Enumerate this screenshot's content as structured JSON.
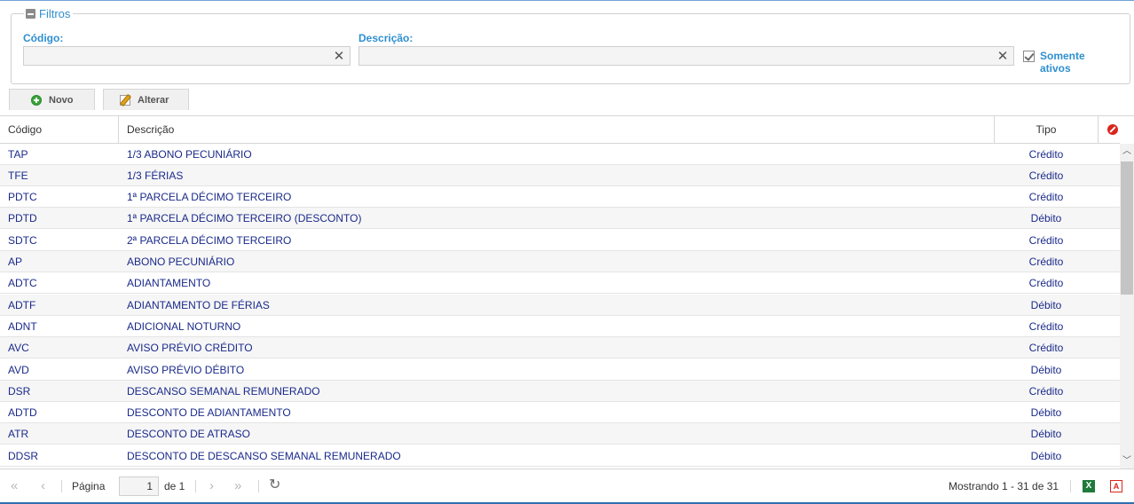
{
  "filters": {
    "legend": "Filtros",
    "codigo_label": "Código:",
    "codigo_value": "",
    "descricao_label": "Descrição:",
    "descricao_value": "",
    "clear_glyph": "✕",
    "somente_ativos_label": "Somente ativos",
    "somente_ativos_checked": true
  },
  "toolbar": {
    "novo_label": "Novo",
    "alterar_label": "Alterar"
  },
  "grid": {
    "columns": {
      "codigo": "Código",
      "descricao": "Descrição",
      "tipo": "Tipo"
    },
    "rows": [
      {
        "codigo": "TAP",
        "descricao": "1/3 ABONO PECUNIÁRIO",
        "tipo": "Crédito"
      },
      {
        "codigo": "TFE",
        "descricao": "1/3 FÉRIAS",
        "tipo": "Crédito"
      },
      {
        "codigo": "PDTC",
        "descricao": "1ª PARCELA DÉCIMO TERCEIRO",
        "tipo": "Crédito"
      },
      {
        "codigo": "PDTD",
        "descricao": "1ª PARCELA DÉCIMO TERCEIRO (DESCONTO)",
        "tipo": "Débito"
      },
      {
        "codigo": "SDTC",
        "descricao": "2ª PARCELA DÉCIMO TERCEIRO",
        "tipo": "Crédito"
      },
      {
        "codigo": "AP",
        "descricao": "ABONO PECUNIÁRIO",
        "tipo": "Crédito"
      },
      {
        "codigo": "ADTC",
        "descricao": "ADIANTAMENTO",
        "tipo": "Crédito"
      },
      {
        "codigo": "ADTF",
        "descricao": "ADIANTAMENTO DE FÉRIAS",
        "tipo": "Débito"
      },
      {
        "codigo": "ADNT",
        "descricao": "ADICIONAL NOTURNO",
        "tipo": "Crédito"
      },
      {
        "codigo": "AVC",
        "descricao": "AVISO PRÉVIO CRÉDITO",
        "tipo": "Crédito"
      },
      {
        "codigo": "AVD",
        "descricao": "AVISO PRÉVIO DÉBITO",
        "tipo": "Débito"
      },
      {
        "codigo": "DSR",
        "descricao": "DESCANSO SEMANAL REMUNERADO",
        "tipo": "Crédito"
      },
      {
        "codigo": "ADTD",
        "descricao": "DESCONTO DE ADIANTAMENTO",
        "tipo": "Débito"
      },
      {
        "codigo": "ATR",
        "descricao": "DESCONTO DE ATRASO",
        "tipo": "Débito"
      },
      {
        "codigo": "DDSR",
        "descricao": "DESCONTO DE DESCANSO SEMANAL REMUNERADO",
        "tipo": "Débito"
      }
    ]
  },
  "pager": {
    "first_glyph": "«",
    "prev_glyph": "‹",
    "next_glyph": "›",
    "last_glyph": "»",
    "refresh_glyph": "↻",
    "pagina_label": "Página",
    "page_value": "1",
    "de_label": "de 1",
    "showing_text": "Mostrando 1 - 31 de 31",
    "excel_glyph": "X",
    "pdf_glyph": "A"
  },
  "scroll": {
    "up_glyph": "︿",
    "down_glyph": "﹀"
  },
  "colors": {
    "accent": "#2f8fd0",
    "row_text": "#1a2a8a",
    "alt_row": "#f6f6f6"
  }
}
